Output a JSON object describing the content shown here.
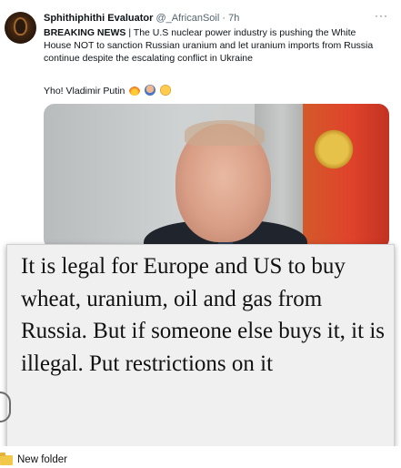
{
  "tweet": {
    "author_name": "Sphithiphithi Evaluator",
    "author_handle": "@_AfricanSoil",
    "separator": "·",
    "time": "7h",
    "more_label": "···",
    "breaking_label": "BREAKING NEWS",
    "body": " | The U.S nuclear power industry is pushing the White House NOT to sanction Russian uranium and let uranium imports from Russia continue despite the escalating conflict in Ukraine",
    "reply_line": "Yho! Vladimir Putin",
    "emojis": [
      "fire-emoji",
      "person-gesturing-emoji",
      "face-with-hand-over-mouth-emoji"
    ]
  },
  "overlay": {
    "text": "It is legal for Europe and US to buy wheat, uranium, oil and gas from Russia. But if someone else buys it, it is illegal. Put restrictions on it"
  },
  "desktop": {
    "folder_label": "New folder"
  },
  "colors": {
    "text_primary": "#0f1419",
    "text_secondary": "#536471",
    "overlay_bg": "#f0f0f0",
    "folder": "#f2c84b"
  }
}
